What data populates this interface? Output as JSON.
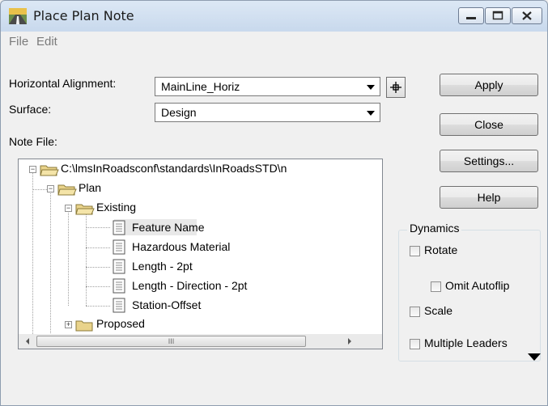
{
  "window": {
    "title": "Place Plan Note"
  },
  "menu": {
    "file": "File",
    "edit": "Edit"
  },
  "form": {
    "horizontal_alignment_label": "Horizontal Alignment:",
    "horizontal_alignment_value": "MainLine_Horiz",
    "surface_label": "Surface:",
    "surface_value": "Design",
    "note_file_label": "Note File:"
  },
  "tree": {
    "root": "C:\\lmsInRoadsconf\\standards\\InRoadsSTD\\n",
    "plan": "Plan",
    "existing": "Existing",
    "items": [
      "Feature Name",
      "Hazardous Material",
      "Length - 2pt",
      "Length - Direction - 2pt",
      "Station-Offset"
    ],
    "proposed": "Proposed",
    "hscroll_grip": "III"
  },
  "buttons": {
    "apply": "Apply",
    "close": "Close",
    "settings": "Settings...",
    "help": "Help"
  },
  "dynamics": {
    "title": "Dynamics",
    "rotate": "Rotate",
    "omit_autoflip": "Omit Autoflip",
    "scale": "Scale",
    "multiple_leaders": "Multiple Leaders"
  }
}
